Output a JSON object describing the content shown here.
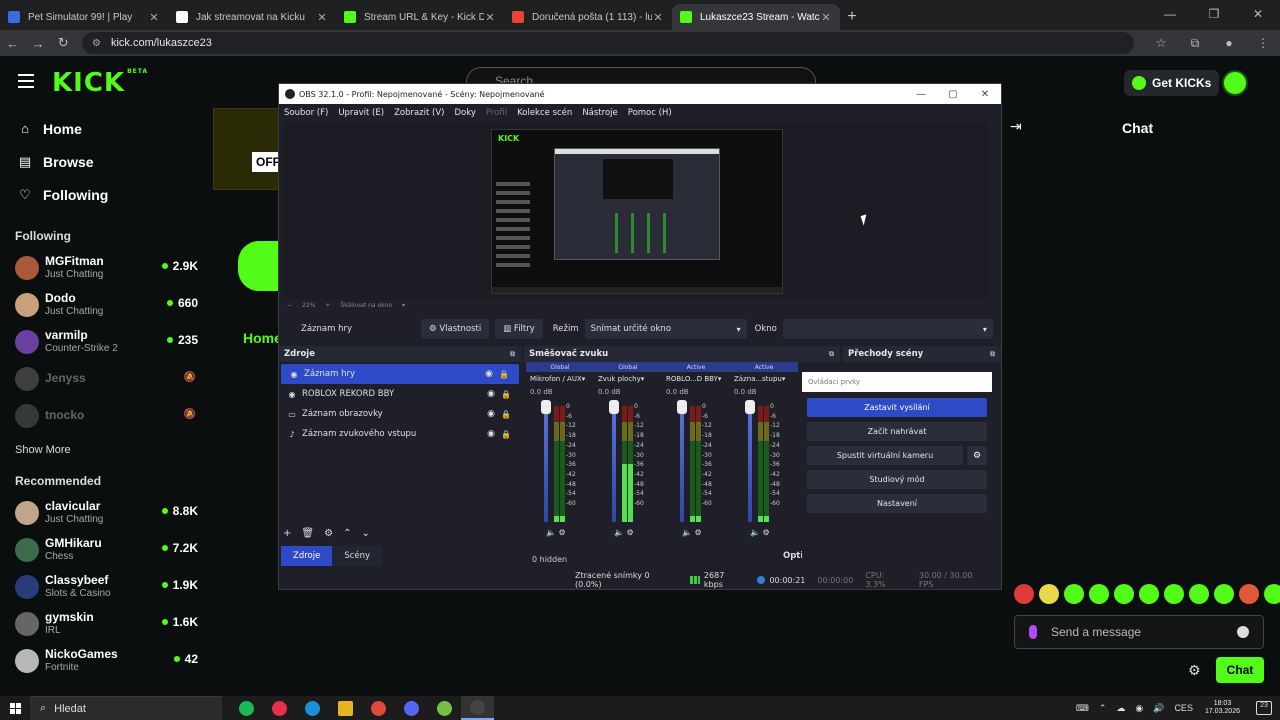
{
  "browser": {
    "tabs": [
      {
        "title": "Pet Simulator 99! | Play",
        "color": "#3e6ae1"
      },
      {
        "title": "Jak streamovat na Kicku",
        "color": "#ffffff"
      },
      {
        "title": "Stream URL & Key - Kick Dashb",
        "color": "#53fc18"
      },
      {
        "title": "Doručená pošta (1 113) - lukasl",
        "color": "#ea4335"
      },
      {
        "title": "Lukaszce23 Stream - Watch Live",
        "color": "#53fc18"
      }
    ],
    "url": "kick.com/lukaszce23"
  },
  "kick": {
    "logo": "KICK",
    "logo_badge": "BETA",
    "search_placeholder": "Search",
    "get_kicks": "Get KICKs",
    "nav": [
      {
        "label": "Home",
        "icon": "⌂"
      },
      {
        "label": "Browse",
        "icon": "▤"
      },
      {
        "label": "Following",
        "icon": "♡"
      }
    ],
    "following_title": "Following",
    "following": [
      {
        "name": "MGFitman",
        "category": "Just Chatting",
        "viewers": "2.9K",
        "color": "#a85a3b"
      },
      {
        "name": "Dodo",
        "category": "Just Chatting",
        "viewers": "660",
        "color": "#c9a07a"
      },
      {
        "name": "varmilp",
        "category": "Counter-Strike 2",
        "viewers": "235",
        "color": "#6b3fa0"
      }
    ],
    "following_offline": [
      {
        "name": "Jenyss",
        "color": "#888888"
      },
      {
        "name": "tnocko",
        "color": "#777777"
      }
    ],
    "show_more": "Show More",
    "recommended_title": "Recommended",
    "recommended": [
      {
        "name": "clavicular",
        "category": "Just Chatting",
        "viewers": "8.8K",
        "color": "#c0a58a"
      },
      {
        "name": "GMHikaru",
        "category": "Chess",
        "viewers": "7.2K",
        "color": "#3d6a4a"
      },
      {
        "name": "Classybeef",
        "category": "Slots & Casino",
        "viewers": "1.9K",
        "color": "#2a3c78"
      },
      {
        "name": "gymskin",
        "category": "IRL",
        "viewers": "1.6K",
        "color": "#666666"
      },
      {
        "name": "NickoGames",
        "category": "Fortnite",
        "viewers": "42",
        "color": "#b8b8b8"
      }
    ],
    "offline_label": "OFF",
    "home_tab": "Home",
    "chat_title": "Chat",
    "message_placeholder": "Send a message",
    "chat_button": "Chat",
    "emote_colors": [
      "#e03a3a",
      "#e8d84a",
      "#53fc18",
      "#53fc18",
      "#53fc18",
      "#53fc18",
      "#53fc18",
      "#53fc18",
      "#53fc18",
      "#e05a3a",
      "#53fc18"
    ]
  },
  "obs": {
    "title": "OBS 32.1.0 - Profil: Nepojmenované - Scény: Nepojmenované",
    "menu": [
      "Soubor (F)",
      "Upravit (E)",
      "Zobrazit (V)",
      "Doky",
      "Profil",
      "Kolekce scén",
      "Nástroje",
      "Pomoc (H)"
    ],
    "zoom": "22%",
    "zoom_mode": "Škálovat na okno",
    "selected_source": "Záznam hry",
    "properties": "Vlastnosti",
    "filters": "Filtry",
    "mode_label": "Režim",
    "mode_value": "Snímat určité okno",
    "window_label": "Okno",
    "sources_title": "Zdroje",
    "sources": [
      {
        "name": "Záznam hry",
        "icon": "◉"
      },
      {
        "name": "ROBLOX REKORD BBY",
        "icon": "◉"
      },
      {
        "name": "Záznam obrazovky",
        "icon": "▭"
      },
      {
        "name": "Záznam zvukového vstupu",
        "icon": "♪"
      }
    ],
    "dock_tabs": [
      "Zdroje",
      "Scény"
    ],
    "mixer_title": "Směšovač zvuku",
    "mixer_channels": [
      {
        "scope": "Global",
        "name": "Mikrofon / AUX",
        "db": "0.0 dB",
        "level": 0.05
      },
      {
        "scope": "Global",
        "name": "Zvuk plochy",
        "db": "0.0 dB",
        "level": 0.5
      },
      {
        "scope": "Active",
        "name": "ROBLO...D BBY",
        "db": "0.0 dB",
        "level": 0.05
      },
      {
        "scope": "Active",
        "name": "Zázna...stupu",
        "db": "0.0 dB",
        "level": 0.05
      }
    ],
    "scale": [
      "0",
      "-6",
      "-12",
      "-18",
      "-24",
      "-30",
      "-36",
      "-42",
      "-48",
      "-54",
      "-60"
    ],
    "hidden": "0 hidden",
    "transitions_title": "Přechody scény",
    "controls_title": "Ovládací prvky",
    "controls": {
      "stop_stream": "Zastavit vysílání",
      "start_record": "Začít nahrávat",
      "virtual_cam": "Spustit virtuální kameru",
      "studio_mode": "Studiový mód",
      "settings": "Nastavení"
    },
    "options_label": "Opti",
    "status": {
      "dropped": "Ztracené snímky 0 (0.0%)",
      "bitrate": "2687 kbps",
      "time": "00:00:21",
      "rec_time": "00:00:00",
      "cpu": "CPU: 3.3%",
      "fps": "30.00 / 30.00 FPS"
    }
  },
  "taskbar": {
    "search": "Hledat",
    "apps": [
      {
        "name": "spotify",
        "color": "#1db954"
      },
      {
        "name": "youtube-music",
        "color": "#e8304a"
      },
      {
        "name": "edge",
        "color": "#1d8fd6"
      },
      {
        "name": "explorer",
        "color": "#e6b422"
      },
      {
        "name": "chrome",
        "color": "#e04a3a"
      },
      {
        "name": "discord",
        "color": "#5865f2"
      },
      {
        "name": "android",
        "color": "#74c043"
      },
      {
        "name": "obs",
        "color": "#444444"
      }
    ],
    "lang": "CES",
    "time": "18:03",
    "date": "17.03.2026",
    "notifications": "23"
  }
}
